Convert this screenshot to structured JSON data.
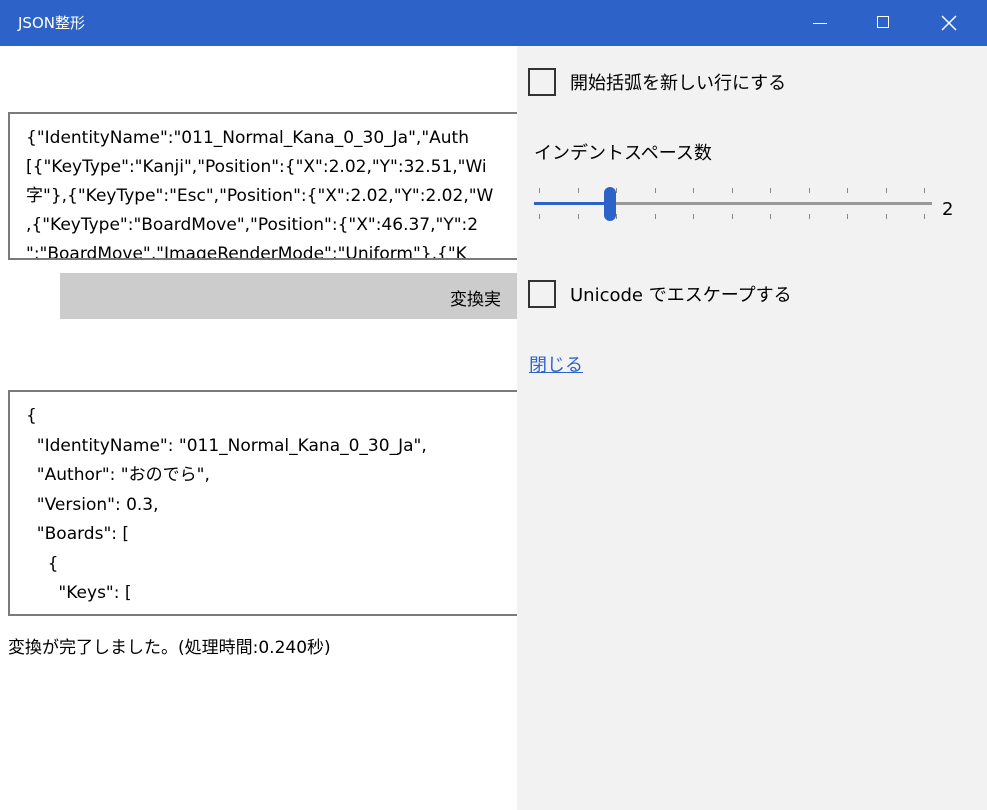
{
  "window": {
    "title": "JSON整形",
    "minimize_icon": "minimize-icon",
    "maximize_icon": "maximize-icon",
    "close_icon": "close-icon",
    "titlebar_color": "#2d63c8"
  },
  "input": {
    "lines": [
      "{\"IdentityName\":\"011_Normal_Kana_0_30_Ja\",\"Auth",
      "[{\"KeyType\":\"Kanji\",\"Position\":{\"X\":2.02,\"Y\":32.51,\"Wi",
      "字\"},{\"KeyType\":\"Esc\",\"Position\":{\"X\":2.02,\"Y\":2.02,\"W",
      ",{\"KeyType\":\"BoardMove\",\"Position\":{\"X\":46.37,\"Y\":2",
      "\":\"BoardMove\",\"ImageRenderMode\":\"Uniform\"},{\"K"
    ]
  },
  "convert_button": {
    "label": "変換実"
  },
  "output": {
    "lines": [
      "{",
      "  \"IdentityName\": \"011_Normal_Kana_0_30_Ja\",",
      "  \"Author\": \"おのでら\",",
      "  \"Version\": 0.3,",
      "  \"Boards\": [",
      "    {",
      "      \"Keys\": ["
    ]
  },
  "status": {
    "text": "変換が完了しました。(処理時間:0.240秒)"
  },
  "settings": {
    "bracket_newline_label": "開始括弧を新しい行にする",
    "bracket_newline_checked": false,
    "indent_label": "インデントスペース数",
    "indent_value": "2",
    "indent_min": 0,
    "indent_max": 10,
    "unicode_escape_label": "Unicode でエスケープする",
    "unicode_escape_checked": false,
    "close_link": "閉じる",
    "accent_color": "#2d63c8",
    "panel_bg": "#f2f2f2"
  }
}
